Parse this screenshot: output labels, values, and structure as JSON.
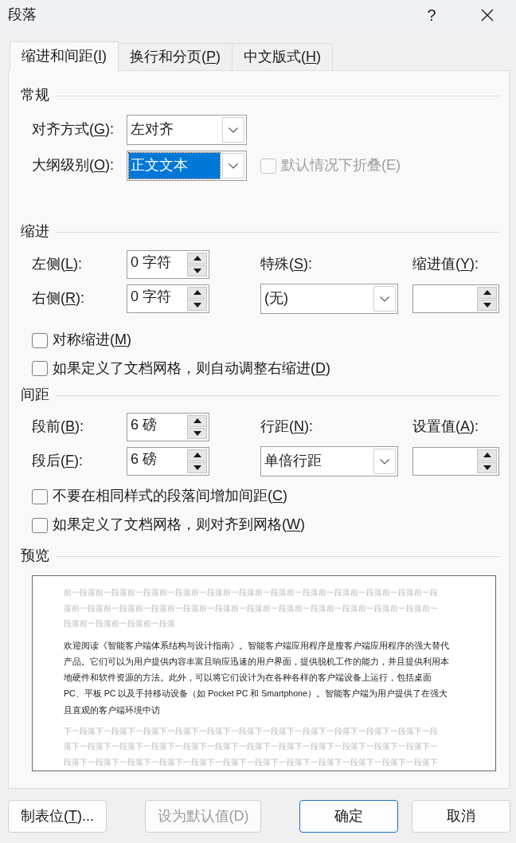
{
  "window": {
    "title": "段落",
    "help_button": "?"
  },
  "tabs": [
    {
      "label": "缩进和间距(I)",
      "mnemonic_underlined": true,
      "selected": true
    },
    {
      "label": "换行和分页(P)",
      "mnemonic_underlined": true,
      "selected": false
    },
    {
      "label": "中文版式(H)",
      "mnemonic_underlined": true,
      "selected": false
    }
  ],
  "general": {
    "heading": "常规",
    "alignment": {
      "label": "对齐方式(G):",
      "mnemonic_underlined": true,
      "value": "左对齐"
    },
    "outline_level": {
      "label": "大纲级别(O):",
      "mnemonic_underlined": true,
      "value": "正文文本",
      "highlighted": true
    },
    "collapse_by_default": {
      "label": "默认情况下折叠(E)",
      "mnemonic_underlined": false,
      "checked": false,
      "disabled": true
    }
  },
  "indentation": {
    "heading": "缩进",
    "left": {
      "label": "左侧(L):",
      "mnemonic_underlined": true,
      "value": "0 字符"
    },
    "right": {
      "label": "右侧(R):",
      "mnemonic_underlined": true,
      "value": "0 字符"
    },
    "special": {
      "label": "特殊(S):",
      "mnemonic_underlined": true,
      "value": "(无)"
    },
    "by": {
      "label": "缩进值(Y):",
      "mnemonic_underlined": true
    },
    "checkboxes": [
      {
        "label": "对称缩进(M)",
        "mnemonic_underlined": true,
        "checked": false
      },
      {
        "label": "如果定义了文档网格，则自动调整右缩进(D)",
        "mnemonic_underlined": true,
        "checked": false
      }
    ]
  },
  "spacing": {
    "heading": "间距",
    "before": {
      "label": "段前(B):",
      "mnemonic_underlined": true,
      "value": "6 磅"
    },
    "after": {
      "label": "段后(F):",
      "mnemonic_underlined": true,
      "value": "6 磅"
    },
    "line_spacing": {
      "label": "行距(N):",
      "mnemonic_underlined": true,
      "value": "单倍行距"
    },
    "at": {
      "label": "设置值(A):",
      "mnemonic_underlined": true
    },
    "checkboxes": [
      {
        "label": "不要在相同样式的段落间增加间距(C)",
        "mnemonic_underlined": true,
        "checked": false
      },
      {
        "label": "如果定义了文档网格，则对齐到网格(W)",
        "mnemonic_underlined": true,
        "checked": false
      }
    ]
  },
  "preview": {
    "heading": "预览",
    "previous_paragraph": "前一段落前一段落前一段落前一段落前一段落前一段落前一段落前一段落前一段落前一段落前一段落前一段落前一段落前一段落前一段落前一段落前一段落前一段落前一段落前一段落前一段落前一段落前一段落前一段落前一段落前一段落前一段落",
    "sample_paragraph": "欢迎阅读《智能客户端体系结构与设计指南》。智能客户端应用程序是瘦客户端应用程序的强大替代产品。它们可以为用户提供内容丰富且响应迅速的用户界面，提供脱机工作的能力，并且提供利用本地硬件和软件资源的方法。此外，可以将它们设计为在各种各样的客户端设备上运行，包括桌面 PC、平板 PC 以及手持移动设备（如 Pocket PC 和 Smartphone）。智能客户端为用户提供了在强大且直观的客户端环境中访",
    "next_paragraph": "下一段落下一段落下一段落下一段落下一段落下一段落下一段落下一段落下一段落下一段落下一段落下一段落下一段落下一段落下一段落下一段落下一段落下一段落下一段落下一段落下一段落下一段落下一段落下一段落下一段落下一段落下一段落下一段落下一段落下一段落下一段落下一段落下一段落下一段落下一段落下"
  },
  "buttons": [
    {
      "label": "制表位(T)...",
      "mnemonic_underlined": true,
      "disabled": false,
      "default": false
    },
    {
      "label": "设为默认值(D)",
      "mnemonic_underlined": false,
      "disabled": true,
      "default": false
    },
    {
      "label": "确定",
      "disabled": false,
      "default": true
    },
    {
      "label": "取消",
      "disabled": false,
      "default": false
    }
  ]
}
